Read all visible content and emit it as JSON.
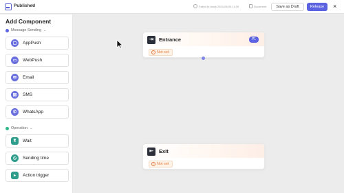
{
  "header": {
    "title": "Published",
    "meta_text": "Failed to block 2024-08-09 11:30",
    "document_label": "Document",
    "save_draft_label": "Save as Draft",
    "release_label": "Release",
    "close_label": "×"
  },
  "sidebar": {
    "title": "Add Component",
    "section_message": "Message Sending",
    "section_operation": "Operation",
    "message_items": [
      {
        "label": "AppPush",
        "icon": "app-push-icon"
      },
      {
        "label": "WebPush",
        "icon": "web-push-icon"
      },
      {
        "label": "Email",
        "icon": "email-icon"
      },
      {
        "label": "SMS",
        "icon": "sms-icon"
      },
      {
        "label": "WhatsApp",
        "icon": "whatsapp-icon"
      }
    ],
    "operation_items": [
      {
        "label": "Wait",
        "icon": "hourglass-icon"
      },
      {
        "label": "Sending time",
        "icon": "clock-icon"
      },
      {
        "label": "Action trigger",
        "icon": "trigger-icon"
      }
    ]
  },
  "canvas": {
    "entrance": {
      "title": "Entrance",
      "badge": "P1",
      "status": "Not set"
    },
    "exit": {
      "title": "Exit",
      "status": "Not set"
    }
  },
  "colors": {
    "accent": "#5b63e0",
    "warning": "#e07a3f",
    "operation_teal": "#2e9c8a",
    "message_dot": "#5b63e0",
    "operation_dot": "#2eb88a"
  }
}
